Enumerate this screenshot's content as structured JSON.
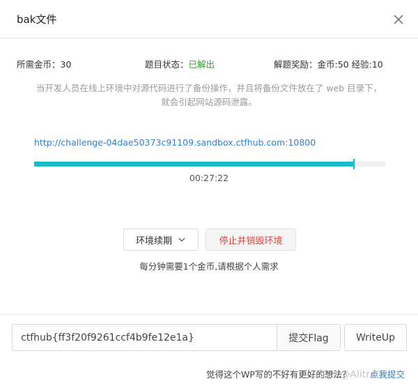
{
  "modal": {
    "title": "bak文件"
  },
  "info": {
    "coins_label": "所需金币：",
    "coins_value": "30",
    "status_label": "题目状态：",
    "status_value": "已解出",
    "reward_label": "解题奖励：",
    "reward_value": "金币:50 经验:10"
  },
  "description": {
    "line1": "当开发人员在线上环境中对源代码进行了备份操作，并且将备份文件放在了 web 目录下，",
    "line2": "就会引起网站源码泄露。"
  },
  "environment": {
    "url": "http://challenge-04dae50373c91109.sandbox.ctfhub.com:10800",
    "remaining_time": "00:27:22",
    "progress_fraction": 0.91
  },
  "actions": {
    "renew_label": "环境续期",
    "destroy_label": "停止并销毁环境",
    "note": "每分钟需要1个金币,请根据个人需求"
  },
  "flag": {
    "value": "ctfhub{ff3f20f9261ccf4b9fe12e1a}",
    "submit_label": "提交Flag",
    "writeup_label": "WriteUp"
  },
  "footer": {
    "text": "觉得这个WP写的不好有更好的想法？",
    "link": "点我提交"
  },
  "watermark": "CSDN @Alitra X",
  "colors": {
    "accent": "#19bcc4",
    "link": "#2f7fd0",
    "solved": "#2f9e2f",
    "danger": "#e0453a"
  },
  "icons": {
    "close": "close-icon",
    "dropdown": "chevron-down-icon"
  }
}
